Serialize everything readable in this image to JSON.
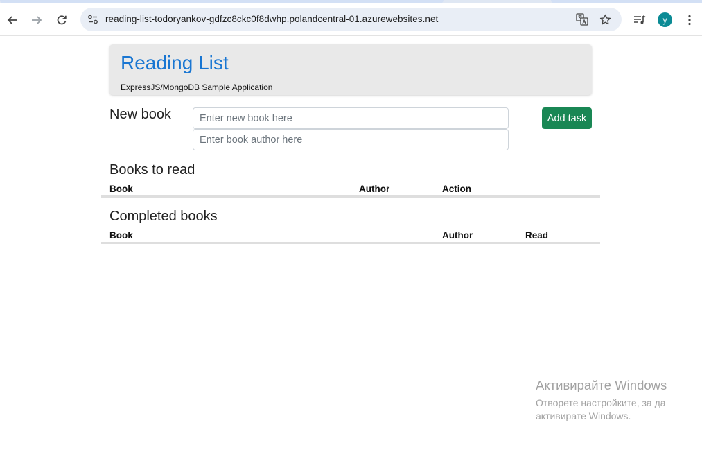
{
  "browser": {
    "url": "reading-list-todoryankov-gdfzc8ckc0f8dwhp.polandcentral-01.azurewebsites.net",
    "avatar_letter": "y",
    "avatar_color": "#0b8b95"
  },
  "header": {
    "title": "Reading List",
    "subtitle": "ExpressJS/MongoDB Sample Application",
    "title_color": "#1976d2"
  },
  "new_book": {
    "label": "New book",
    "book_placeholder": "Enter new book here",
    "author_placeholder": "Enter book author here",
    "add_label": "Add task",
    "add_color": "#198754"
  },
  "to_read": {
    "title": "Books to read",
    "columns": [
      "Book",
      "Author",
      "Action"
    ]
  },
  "completed": {
    "title": "Completed books",
    "columns": [
      "Book",
      "Author",
      "Read"
    ]
  },
  "watermark": {
    "title": "Активирайте Windows",
    "line1": "Отворете настройките, за да",
    "line2": "активирате Windows."
  }
}
